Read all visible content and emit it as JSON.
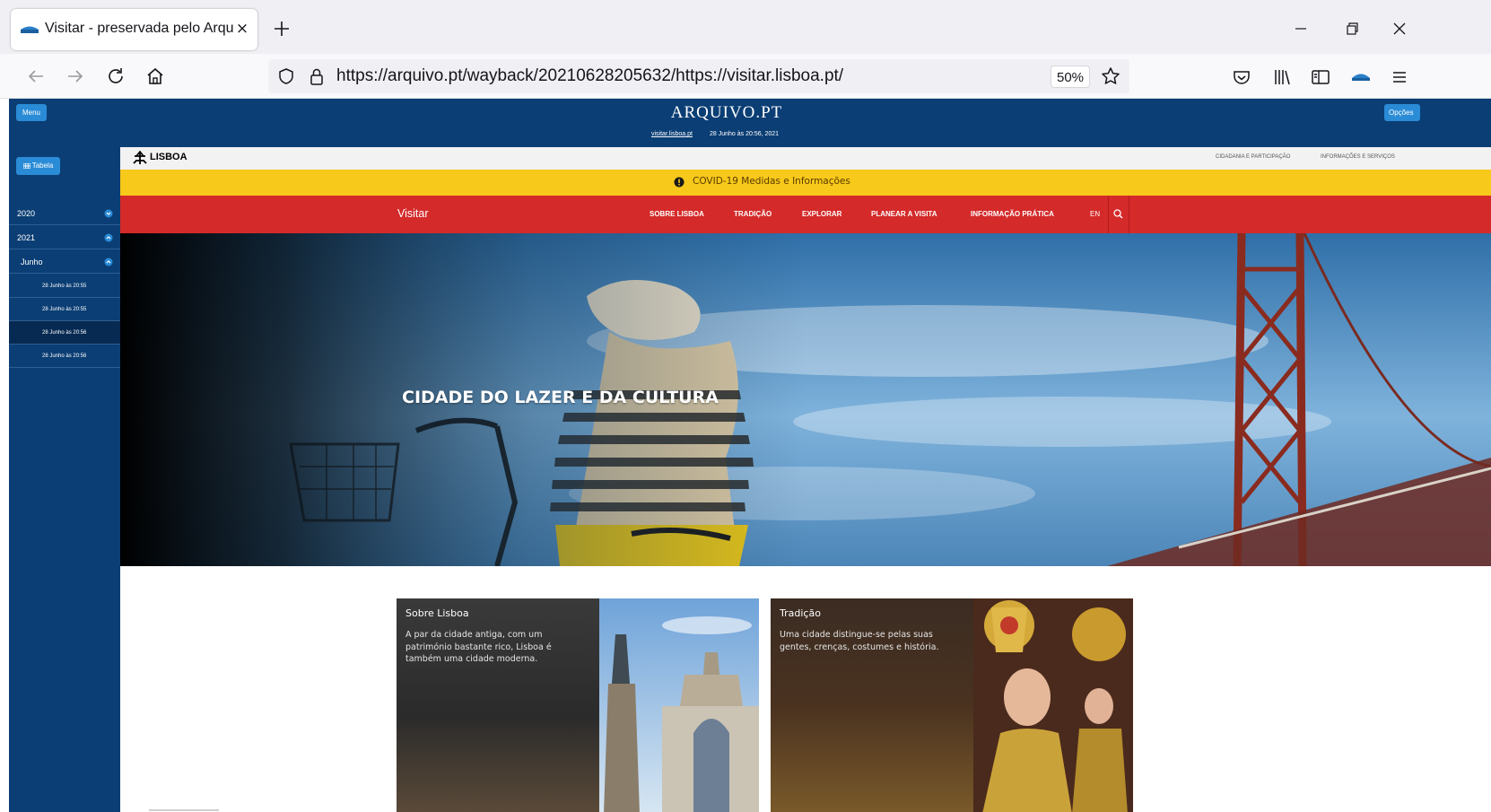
{
  "browser": {
    "tab_title": "Visitar - preservada pelo Arquivo.pt",
    "tab_close": "×",
    "url": "https://arquivo.pt/wayback/20210628205632/https://visitar.lisboa.pt/",
    "zoom": "50%"
  },
  "arquivo": {
    "menu_label": "Menu",
    "logo_text": "ARQUIVO.PT",
    "site_link": "visitar.lisboa.pt",
    "capture_date": "28 Junho às 20:56, 2021",
    "options_label": "Opções",
    "table_label": "Tabela",
    "timeline": [
      {
        "label": "2020",
        "chevron": "down"
      },
      {
        "label": "2021",
        "chevron": "up"
      },
      {
        "label": "Junho",
        "chevron": "up"
      },
      {
        "label": "28 Junho às 20:55"
      },
      {
        "label": "28 Junho às 20:55"
      },
      {
        "label": "28 Junho às 20:56"
      },
      {
        "label": "28 Junho às 20:56"
      }
    ]
  },
  "site": {
    "logo_text": "LISBOA",
    "top_links": [
      "CIDADANIA E PARTICIPAÇÃO",
      "INFORMAÇÕES E SERVIÇOS"
    ],
    "covid_text": "COVID-19 Medidas e Informações",
    "nav_brand": "Visitar",
    "nav_links": [
      "SOBRE LISBOA",
      "TRADIÇÃO",
      "EXPLORAR",
      "PLANEAR A VISITA",
      "INFORMAÇÃO PRÁTICA"
    ],
    "nav_lang": "EN",
    "hero_title": "CIDADE DO LAZER E DA CULTURA",
    "cards": [
      {
        "title": "Sobre Lisboa",
        "text": "A par da cidade antiga, com um património bastante rico, Lisboa é também uma cidade moderna."
      },
      {
        "title": "Tradição",
        "text": "Uma cidade distingue-se pelas suas gentes, crenças, costumes e história."
      }
    ]
  },
  "colors": {
    "arquivo_blue": "#0b3e74",
    "arquivo_button": "#2a8bd6",
    "covid_yellow": "#f7c91a",
    "nav_red": "#d42a2a"
  }
}
